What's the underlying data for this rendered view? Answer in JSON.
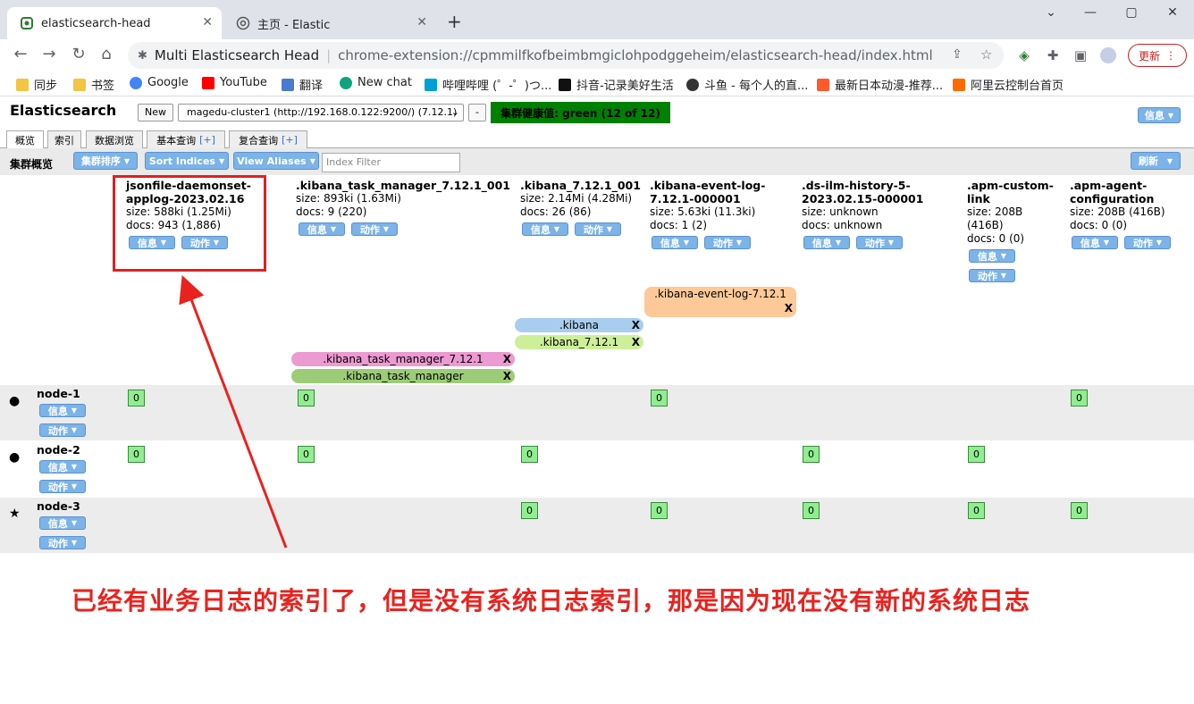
{
  "browser": {
    "tabs": [
      {
        "title": "elasticsearch-head",
        "icon": "extension-icon"
      },
      {
        "title": "主页 - Elastic",
        "icon": "elastic-icon"
      }
    ],
    "new_tab": "+",
    "address": {
      "site": "Multi Elasticsearch Head",
      "url": "chrome-extension://cpmmilfkofbeimbmgiclohpodggeheim/elasticsearch-head/index.html"
    },
    "update_label": "更新",
    "bookmarks": [
      {
        "label": "同步",
        "color": "#f4c542"
      },
      {
        "label": "书签",
        "color": "#f4c542"
      },
      {
        "label": "Google",
        "color": "#4285f4"
      },
      {
        "label": "YouTube",
        "color": "#ff0000"
      },
      {
        "label": "翻译",
        "color": "#4a7bd0"
      },
      {
        "label": "New chat",
        "color": "#10a37f"
      },
      {
        "label": "哔哩哔哩 (゜-゜)つ...",
        "color": "#00a1d6"
      },
      {
        "label": "抖音-记录美好生活",
        "color": "#111111"
      },
      {
        "label": "斗鱼 - 每个人的直...",
        "color": "#333333"
      },
      {
        "label": "最新日本动漫-推荐...",
        "color": "#ff5a2c"
      },
      {
        "label": "阿里云控制台首页",
        "color": "#ff6a00"
      }
    ]
  },
  "app": {
    "brand": "Elasticsearch",
    "new_button": "New",
    "cluster": "magedu-cluster1 (http://192.168.0.122:9200/) (7.12.1)",
    "disconnect": "-",
    "health": "集群健康值: green (12 of 12)",
    "info_button": "信息",
    "refresh_button": "刷新",
    "tabs": [
      "概览",
      "索引",
      "数据浏览",
      "基本查询",
      "复合查询"
    ],
    "tab_plus": "[+]",
    "overview_label": "集群概览",
    "sort_cluster": "集群排序",
    "sort_indices": "Sort Indices",
    "view_aliases": "View Aliases",
    "index_filter_placeholder": "Index Filter",
    "info_short": "信息",
    "action_short": "动作"
  },
  "indices": [
    {
      "name1": "jsonfile-daemonset-",
      "name2": "applog-2023.02.16",
      "size": "size: 588ki (1.25Mi)",
      "docs": "docs: 943 (1,886)"
    },
    {
      "name1": ".kibana_task_manager_7.12.1_001",
      "name2": "",
      "size": "size: 893ki (1.63Mi)",
      "docs": "docs: 9 (220)"
    },
    {
      "name1": ".kibana_7.12.1_001",
      "name2": "",
      "size": "size: 2.14Mi (4.28Mi)",
      "docs": "docs: 26 (86)"
    },
    {
      "name1": ".kibana-event-log-",
      "name2": "7.12.1-000001",
      "size": "size: 5.63ki (11.3ki)",
      "docs": "docs: 1 (2)"
    },
    {
      "name1": ".ds-ilm-history-5-",
      "name2": "2023.02.15-000001",
      "size": "size: unknown",
      "docs": "docs: unknown"
    },
    {
      "name1": ".apm-custom-",
      "name2": "link",
      "size": "size: 208B",
      "size2": "(416B)",
      "docs": "docs: 0 (0)"
    },
    {
      "name1": ".apm-agent-",
      "name2": "configuration",
      "size": "size: 208B (416B)",
      "docs": "docs: 0 (0)"
    }
  ],
  "aliases": [
    {
      "name": ".kibana-event-log-7.12.1",
      "color": "#fdc998"
    },
    {
      "name": ".kibana",
      "color": "#a8cdef"
    },
    {
      "name": ".kibana_7.12.1",
      "color": "#cdef9a"
    },
    {
      "name": ".kibana_task_manager_7.12.1",
      "color": "#ec9ad2"
    },
    {
      "name": ".kibana_task_manager",
      "color": "#9ccc78"
    }
  ],
  "alias_remove": "X",
  "nodes": [
    {
      "name": "node-1",
      "marker": "●"
    },
    {
      "name": "node-2",
      "marker": "●"
    },
    {
      "name": "node-3",
      "marker": "★"
    }
  ],
  "shard_label": "0",
  "annotation": "已经有业务日志的索引了，但是没有系统日志索引，那是因为现在没有新的系统日志",
  "colors": {
    "health": "#008000",
    "button": "#7cb3e8",
    "shard": "#90ee90",
    "annotation": "#e8231f"
  }
}
